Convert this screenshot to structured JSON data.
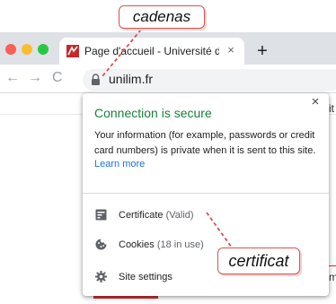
{
  "annotations": {
    "lock_callout": "cadenas",
    "certificate_callout": "certificat"
  },
  "browser": {
    "tab": {
      "title": "Page d'accueil - Université de Li",
      "close_icon": "×"
    },
    "new_tab_icon": "+",
    "nav": {
      "back_icon": "←",
      "forward_icon": "→",
      "reload_icon": "C"
    },
    "url": "unilim.fr"
  },
  "page": {
    "peek_text_1": "it",
    "peek_text_2": "m"
  },
  "popup": {
    "close_icon": "×",
    "title": "Connection is secure",
    "body": "Your information (for example, passwords or credit card numbers) is private when it is sent to this site.",
    "learn_more": "Learn more",
    "rows": [
      {
        "label": "Certificate",
        "sub": "(Valid)",
        "icon": "certificate-icon"
      },
      {
        "label": "Cookies",
        "sub": "(18 in use)",
        "icon": "cookie-icon"
      },
      {
        "label": "Site settings",
        "sub": "",
        "icon": "gear-icon"
      }
    ]
  },
  "colors": {
    "secure_green": "#188038",
    "link_blue": "#1a73e8",
    "annotation_red": "#d9534f"
  }
}
